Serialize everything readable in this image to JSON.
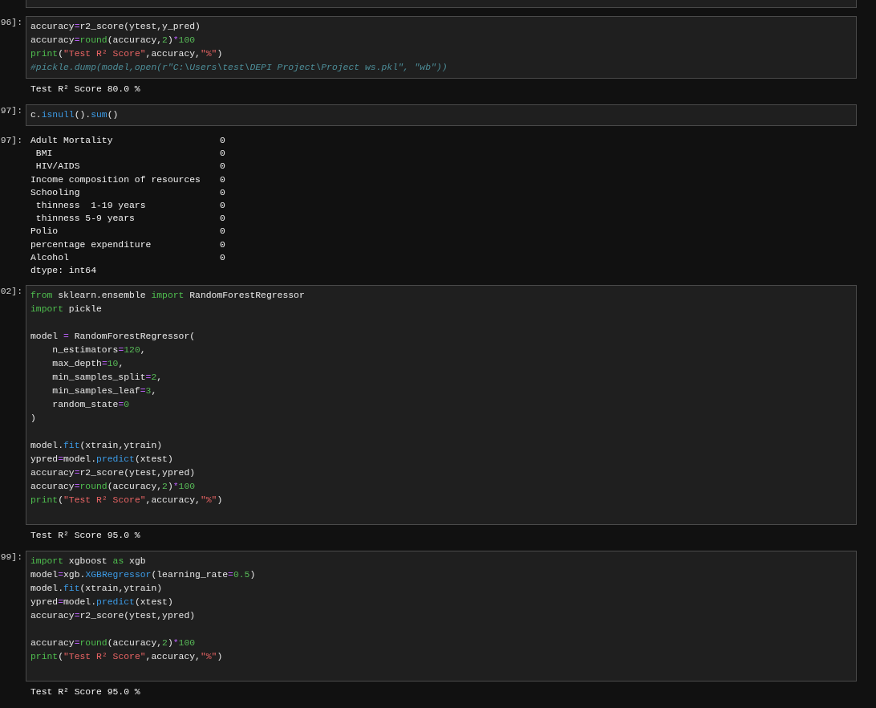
{
  "cells": [
    {
      "prompt": "96]:",
      "lines": [
        {
          "tokens": [
            {
              "kind": "plain",
              "text": "accuracy"
            },
            {
              "kind": "op",
              "text": "="
            },
            {
              "kind": "plain",
              "text": "r2_score(ytest,y_pred)"
            }
          ]
        },
        {
          "tokens": [
            {
              "kind": "plain",
              "text": "accuracy"
            },
            {
              "kind": "op",
              "text": "="
            },
            {
              "kind": "builtin",
              "text": "round"
            },
            {
              "kind": "plain",
              "text": "(accuracy,"
            },
            {
              "kind": "num",
              "text": "2"
            },
            {
              "kind": "plain",
              "text": ")"
            },
            {
              "kind": "op",
              "text": "*"
            },
            {
              "kind": "num",
              "text": "100"
            }
          ]
        },
        {
          "tokens": [
            {
              "kind": "builtin",
              "text": "print"
            },
            {
              "kind": "plain",
              "text": "("
            },
            {
              "kind": "str",
              "text": "\"Test R² Score\""
            },
            {
              "kind": "plain",
              "text": ",accuracy,"
            },
            {
              "kind": "str",
              "text": "\"%\""
            },
            {
              "kind": "plain",
              "text": ")"
            }
          ]
        },
        {
          "tokens": [
            {
              "kind": "comment",
              "text": "#pickle.dump(model,open(r\"C:\\Users\\test\\DEPI Project\\Project ws.pkl\", \"wb\"))"
            }
          ]
        }
      ],
      "output": {
        "kind": "text",
        "lines": [
          "Test R² Score 80.0 %"
        ]
      }
    },
    {
      "prompt": "97]:",
      "lines": [
        {
          "tokens": [
            {
              "kind": "plain",
              "text": "c."
            },
            {
              "kind": "func",
              "text": "isnull"
            },
            {
              "kind": "plain",
              "text": "()."
            },
            {
              "kind": "func",
              "text": "sum"
            },
            {
              "kind": "plain",
              "text": "()"
            }
          ]
        }
      ],
      "output": {
        "kind": "series",
        "prompt": "97]:",
        "rows": [
          {
            "name": "Adult Mortality",
            "value": "0"
          },
          {
            "name": " BMI",
            "value": "0"
          },
          {
            "name": " HIV/AIDS",
            "value": "0"
          },
          {
            "name": "Income composition of resources",
            "value": "0"
          },
          {
            "name": "Schooling",
            "value": "0"
          },
          {
            "name": " thinness  1-19 years",
            "value": "0"
          },
          {
            "name": " thinness 5-9 years",
            "value": "0"
          },
          {
            "name": "Polio",
            "value": "0"
          },
          {
            "name": "percentage expenditure",
            "value": "0"
          },
          {
            "name": "Alcohol",
            "value": "0"
          }
        ],
        "footer": "dtype: int64"
      }
    },
    {
      "prompt": "02]:",
      "lines": [
        {
          "tokens": [
            {
              "kind": "kw",
              "text": "from"
            },
            {
              "kind": "plain",
              "text": " sklearn.ensemble "
            },
            {
              "kind": "kw",
              "text": "import"
            },
            {
              "kind": "plain",
              "text": " RandomForestRegressor"
            }
          ]
        },
        {
          "tokens": [
            {
              "kind": "kw",
              "text": "import"
            },
            {
              "kind": "plain",
              "text": " pickle"
            }
          ],
          "space_after": true
        },
        {
          "tokens": [
            {
              "kind": "plain",
              "text": "model "
            },
            {
              "kind": "op",
              "text": "="
            },
            {
              "kind": "plain",
              "text": " RandomForestRegressor("
            }
          ]
        },
        {
          "tokens": [
            {
              "kind": "plain",
              "text": "    n_estimators"
            },
            {
              "kind": "op",
              "text": "="
            },
            {
              "kind": "num",
              "text": "120"
            },
            {
              "kind": "plain",
              "text": ","
            }
          ]
        },
        {
          "tokens": [
            {
              "kind": "plain",
              "text": "    max_depth"
            },
            {
              "kind": "op",
              "text": "="
            },
            {
              "kind": "num",
              "text": "10"
            },
            {
              "kind": "plain",
              "text": ","
            }
          ]
        },
        {
          "tokens": [
            {
              "kind": "plain",
              "text": "    min_samples_split"
            },
            {
              "kind": "op",
              "text": "="
            },
            {
              "kind": "num",
              "text": "2"
            },
            {
              "kind": "plain",
              "text": ","
            }
          ]
        },
        {
          "tokens": [
            {
              "kind": "plain",
              "text": "    min_samples_leaf"
            },
            {
              "kind": "op",
              "text": "="
            },
            {
              "kind": "num",
              "text": "3"
            },
            {
              "kind": "plain",
              "text": ","
            }
          ]
        },
        {
          "tokens": [
            {
              "kind": "plain",
              "text": "    random_state"
            },
            {
              "kind": "op",
              "text": "="
            },
            {
              "kind": "num",
              "text": "0"
            }
          ]
        },
        {
          "tokens": [
            {
              "kind": "plain",
              "text": ")"
            }
          ],
          "space_after": true
        },
        {
          "tokens": [
            {
              "kind": "plain",
              "text": "model."
            },
            {
              "kind": "func",
              "text": "fit"
            },
            {
              "kind": "plain",
              "text": "(xtrain,ytrain)"
            }
          ]
        },
        {
          "tokens": [
            {
              "kind": "plain",
              "text": "ypred"
            },
            {
              "kind": "op",
              "text": "="
            },
            {
              "kind": "plain",
              "text": "model."
            },
            {
              "kind": "func",
              "text": "predict"
            },
            {
              "kind": "plain",
              "text": "(xtest)"
            }
          ]
        },
        {
          "tokens": [
            {
              "kind": "plain",
              "text": "accuracy"
            },
            {
              "kind": "op",
              "text": "="
            },
            {
              "kind": "plain",
              "text": "r2_score(ytest,ypred)"
            }
          ]
        },
        {
          "tokens": [
            {
              "kind": "plain",
              "text": "accuracy"
            },
            {
              "kind": "op",
              "text": "="
            },
            {
              "kind": "builtin",
              "text": "round"
            },
            {
              "kind": "plain",
              "text": "(accuracy,"
            },
            {
              "kind": "num",
              "text": "2"
            },
            {
              "kind": "plain",
              "text": ")"
            },
            {
              "kind": "op",
              "text": "*"
            },
            {
              "kind": "num",
              "text": "100"
            }
          ]
        },
        {
          "tokens": [
            {
              "kind": "builtin",
              "text": "print"
            },
            {
              "kind": "plain",
              "text": "("
            },
            {
              "kind": "str",
              "text": "\"Test R² Score\""
            },
            {
              "kind": "plain",
              "text": ",accuracy,"
            },
            {
              "kind": "str",
              "text": "\"%\""
            },
            {
              "kind": "plain",
              "text": ")"
            }
          ],
          "space_after": true
        }
      ],
      "output": {
        "kind": "text",
        "lines": [
          "Test R² Score 95.0 %"
        ]
      }
    },
    {
      "prompt": "99]:",
      "lines": [
        {
          "tokens": [
            {
              "kind": "kw",
              "text": "import"
            },
            {
              "kind": "plain",
              "text": " xgboost "
            },
            {
              "kind": "kw",
              "text": "as"
            },
            {
              "kind": "plain",
              "text": " xgb"
            }
          ]
        },
        {
          "tokens": [
            {
              "kind": "plain",
              "text": "model"
            },
            {
              "kind": "op",
              "text": "="
            },
            {
              "kind": "plain",
              "text": "xgb."
            },
            {
              "kind": "func",
              "text": "XGBRegressor"
            },
            {
              "kind": "plain",
              "text": "(learning_rate"
            },
            {
              "kind": "op",
              "text": "="
            },
            {
              "kind": "num",
              "text": "0.5"
            },
            {
              "kind": "plain",
              "text": ")"
            }
          ]
        },
        {
          "tokens": [
            {
              "kind": "plain",
              "text": "model."
            },
            {
              "kind": "func",
              "text": "fit"
            },
            {
              "kind": "plain",
              "text": "(xtrain,ytrain)"
            }
          ]
        },
        {
          "tokens": [
            {
              "kind": "plain",
              "text": "ypred"
            },
            {
              "kind": "op",
              "text": "="
            },
            {
              "kind": "plain",
              "text": "model."
            },
            {
              "kind": "func",
              "text": "predict"
            },
            {
              "kind": "plain",
              "text": "(xtest)"
            }
          ]
        },
        {
          "tokens": [
            {
              "kind": "plain",
              "text": "accuracy"
            },
            {
              "kind": "op",
              "text": "="
            },
            {
              "kind": "plain",
              "text": "r2_score(ytest,ypred)"
            }
          ],
          "space_after": true
        },
        {
          "tokens": [
            {
              "kind": "plain",
              "text": "accuracy"
            },
            {
              "kind": "op",
              "text": "="
            },
            {
              "kind": "builtin",
              "text": "round"
            },
            {
              "kind": "plain",
              "text": "(accuracy,"
            },
            {
              "kind": "num",
              "text": "2"
            },
            {
              "kind": "plain",
              "text": ")"
            },
            {
              "kind": "op",
              "text": "*"
            },
            {
              "kind": "num",
              "text": "100"
            }
          ]
        },
        {
          "tokens": [
            {
              "kind": "builtin",
              "text": "print"
            },
            {
              "kind": "plain",
              "text": "("
            },
            {
              "kind": "str",
              "text": "\"Test R² Score\""
            },
            {
              "kind": "plain",
              "text": ",accuracy,"
            },
            {
              "kind": "str",
              "text": "\"%\""
            },
            {
              "kind": "plain",
              "text": ")"
            }
          ],
          "space_after": true
        }
      ],
      "output": {
        "kind": "text",
        "lines": [
          "Test R² Score 95.0 %"
        ]
      }
    }
  ]
}
